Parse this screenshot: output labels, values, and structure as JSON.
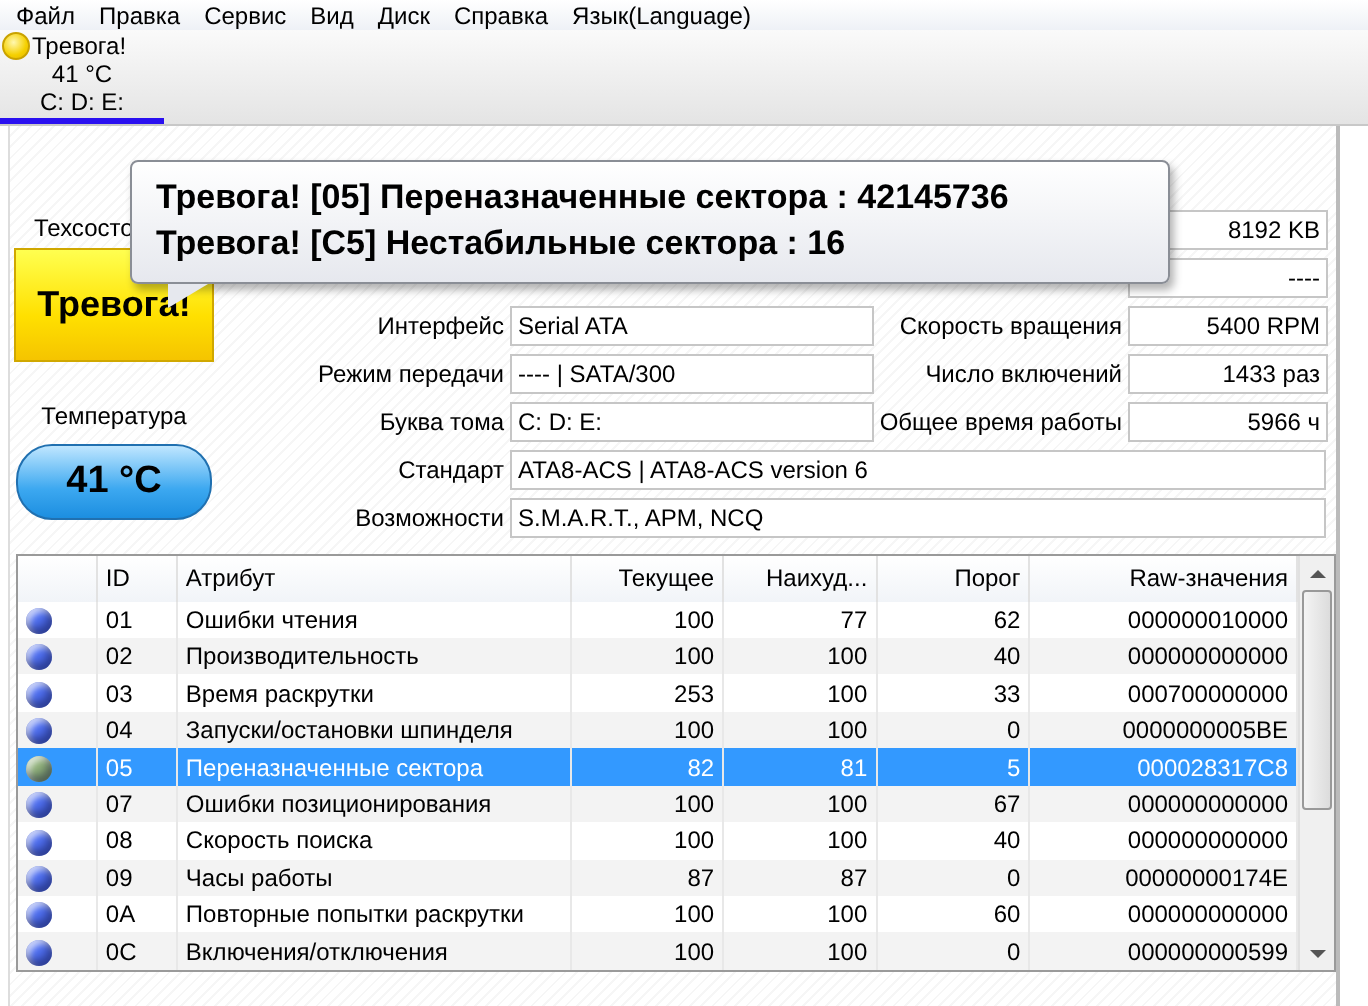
{
  "menu": [
    "Файл",
    "Правка",
    "Сервис",
    "Вид",
    "Диск",
    "Справка",
    "Язык(Language)"
  ],
  "disk_tab": {
    "status": "Тревога!",
    "kind": "caution",
    "temperature": "41 °C",
    "drives": "C: D: E:",
    "selected": true
  },
  "health": {
    "label": "Техсосто",
    "kind": "caution",
    "value": "Тревога!"
  },
  "temperature": {
    "label": "Температура",
    "value": "41 °C"
  },
  "info_rows": [
    {
      "kind": "pair",
      "right": {
        "value": "8192 KB"
      }
    },
    {
      "kind": "pair",
      "right": {
        "value": "----"
      }
    },
    {
      "kind": "pair",
      "left": {
        "label": "Интерфейс",
        "value": "Serial ATA"
      },
      "right": {
        "label": "Скорость вращения",
        "value": "5400 RPM"
      }
    },
    {
      "kind": "pair",
      "left": {
        "label": "Режим передачи",
        "value": "---- | SATA/300"
      },
      "right": {
        "label": "Число включений",
        "value": "1433 раз"
      }
    },
    {
      "kind": "pair",
      "left": {
        "label": "Буква тома",
        "value": "C: D: E:"
      },
      "right": {
        "label": "Общее время работы",
        "value": "5966 ч"
      }
    },
    {
      "kind": "wide",
      "left": {
        "label": "Стандарт",
        "value": "ATA8-ACS | ATA8-ACS version 6"
      }
    },
    {
      "kind": "wide",
      "left": {
        "label": "Возможности",
        "value": "S.M.A.R.T., APM, NCQ"
      }
    }
  ],
  "alert_tooltip": [
    "Тревога! [05] Переназначенные сектора : 42145736",
    "Тревога! [C5] Нестабильные сектора : 16"
  ],
  "table": {
    "columns": [
      "ID",
      "Атрибут",
      "Текущее",
      "Наихуд...",
      "Порог",
      "Raw-значения"
    ],
    "rows": [
      {
        "id": "01",
        "attribute": "Ошибки чтения",
        "current": "100",
        "worst": "77",
        "threshold": "62",
        "raw": "000000010000",
        "color": "#4f6ff0",
        "selected": false
      },
      {
        "id": "02",
        "attribute": "Производительность",
        "current": "100",
        "worst": "100",
        "threshold": "40",
        "raw": "000000000000",
        "color": "#4f6ff0",
        "selected": false
      },
      {
        "id": "03",
        "attribute": "Время раскрутки",
        "current": "253",
        "worst": "100",
        "threshold": "33",
        "raw": "000700000000",
        "color": "#4f6ff0",
        "selected": false
      },
      {
        "id": "04",
        "attribute": "Запуски/остановки шпинделя",
        "current": "100",
        "worst": "100",
        "threshold": "0",
        "raw": "0000000005BE",
        "color": "#4f6ff0",
        "selected": false
      },
      {
        "id": "05",
        "attribute": "Переназначенные сектора",
        "current": "82",
        "worst": "81",
        "threshold": "5",
        "raw": "000028317C8",
        "color": "#8fb07a",
        "selected": true
      },
      {
        "id": "07",
        "attribute": "Ошибки позиционирования",
        "current": "100",
        "worst": "100",
        "threshold": "67",
        "raw": "000000000000",
        "color": "#4f6ff0",
        "selected": false
      },
      {
        "id": "08",
        "attribute": "Скорость поиска",
        "current": "100",
        "worst": "100",
        "threshold": "40",
        "raw": "000000000000",
        "color": "#4f6ff0",
        "selected": false
      },
      {
        "id": "09",
        "attribute": "Часы работы",
        "current": "87",
        "worst": "87",
        "threshold": "0",
        "raw": "00000000174E",
        "color": "#4f6ff0",
        "selected": false
      },
      {
        "id": "0A",
        "attribute": "Повторные попытки раскрутки",
        "current": "100",
        "worst": "100",
        "threshold": "60",
        "raw": "000000000000",
        "color": "#4f6ff0",
        "selected": false
      },
      {
        "id": "0C",
        "attribute": "Включения/отключения",
        "current": "100",
        "worst": "100",
        "threshold": "0",
        "raw": "000000000599",
        "color": "#4f6ff0",
        "selected": false
      }
    ]
  }
}
